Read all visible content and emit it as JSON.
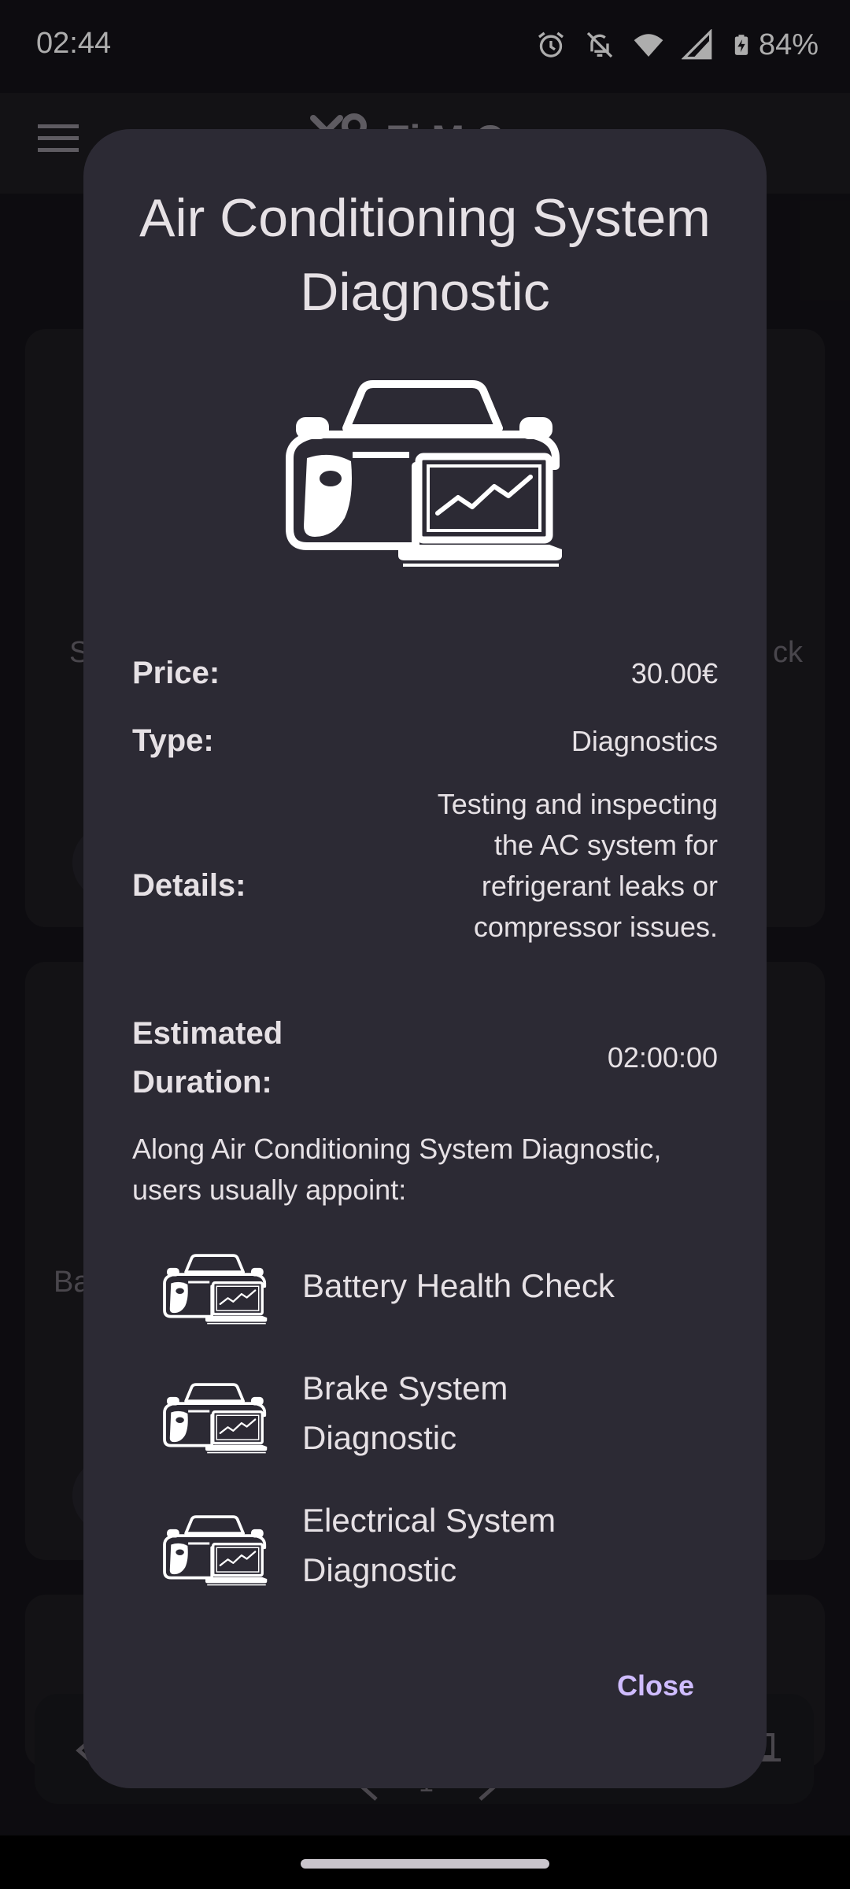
{
  "status_bar": {
    "time": "02:44",
    "battery": "84%",
    "icons": [
      "alarm-icon",
      "bell-off-icon",
      "wifi-icon",
      "signal-icon",
      "battery-charging-icon"
    ]
  },
  "background": {
    "app_title_fragment": "Fi M C",
    "card1_left_text": "S",
    "card1_right_text": "ck",
    "card2_left_text": "Ba",
    "pager_page": "1"
  },
  "dialog": {
    "title": "Air Conditioning System Diagnostic",
    "hero_icon": "car-diagnostic-icon",
    "price_label": "Price:",
    "price_value": "30.00€",
    "type_label": "Type:",
    "type_value": "Diagnostics",
    "details_label": "Details:",
    "details_value": "Testing and inspecting the AC system for refrigerant leaks or compressor issues.",
    "duration_label": "Estimated Duration:",
    "duration_value": "02:00:00",
    "along_text": "Along Air Conditioning System Diagnostic, users usually appoint:",
    "related": [
      {
        "label": "Battery Health Check",
        "icon": "car-diagnostic-icon"
      },
      {
        "label": "Brake System Diagnostic",
        "icon": "car-diagnostic-icon"
      },
      {
        "label": "Electrical System Diagnostic",
        "icon": "car-diagnostic-icon"
      }
    ],
    "close_label": "Close"
  },
  "colors": {
    "dialog_bg": "#2c2a34",
    "accent": "#cfbcff",
    "text": "#e6e1e5"
  }
}
